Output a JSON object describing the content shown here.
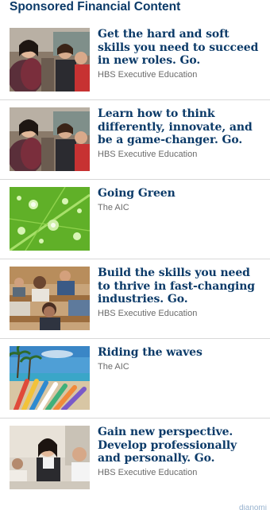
{
  "header": {
    "title": "Sponsored Financial Content"
  },
  "items": [
    {
      "title": "Get the hard and soft skills you need to succeed in new roles. Go.",
      "source": "HBS Executive Education",
      "image": "classroom-people-photo"
    },
    {
      "title": "Learn how to think differently, innovate, and be a game-changer. Go.",
      "source": "HBS Executive Education",
      "image": "classroom-people-photo"
    },
    {
      "title": "Going Green",
      "source": "The AIC",
      "image": "green-leaf-water-drops-photo"
    },
    {
      "title": "Build the skills you need to thrive in fast-changing industries. Go.",
      "source": "HBS Executive Education",
      "image": "lecture-hall-students-photo"
    },
    {
      "title": "Riding the waves",
      "source": "The AIC",
      "image": "surfboards-beach-photo"
    },
    {
      "title": "Gain new perspective. Develop professionally and personally. Go.",
      "source": "HBS Executive Education",
      "image": "seminar-participants-photo"
    }
  ],
  "footer": {
    "logo_text": "dianomi"
  },
  "colors": {
    "title": "#0b3a68",
    "source": "#6b6b6b",
    "divider": "#d8d8d8"
  }
}
